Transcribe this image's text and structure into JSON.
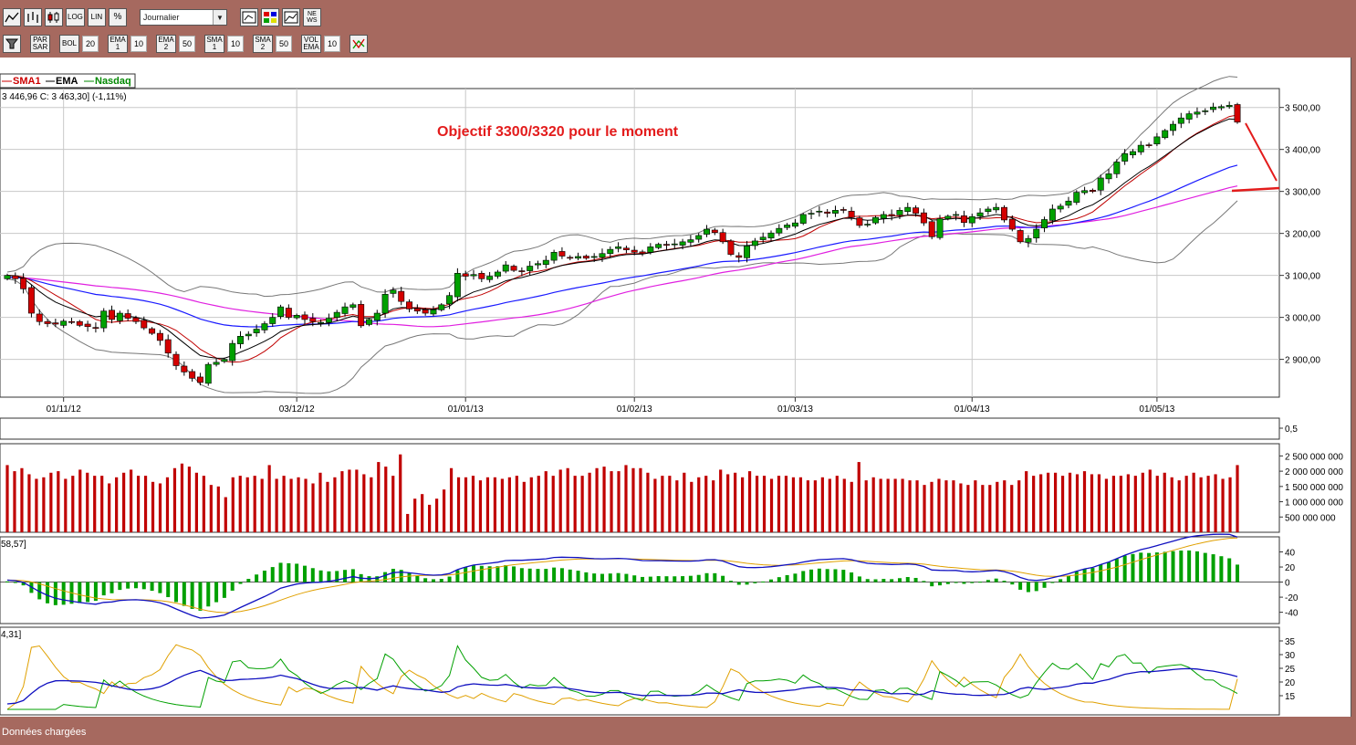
{
  "toolbar_top": {
    "chart_type_icons": [
      "line-chart-icon",
      "bar-chart-icon",
      "candlestick-icon"
    ],
    "scale_buttons": [
      "LOG",
      "LIN",
      "%"
    ],
    "period_select": "Journalier",
    "right_icons": [
      "zoom-icon",
      "color-palette-icon",
      "compare-icon",
      "news-icon"
    ],
    "news_label": "NE WS"
  },
  "toolbar_indicators": [
    {
      "label": "PAR SAR",
      "value": ""
    },
    {
      "label": "BOL",
      "value": "20"
    },
    {
      "label": "EMA 1",
      "value": "10"
    },
    {
      "label": "EMA 2",
      "value": "50"
    },
    {
      "label": "SMA 1",
      "value": "10"
    },
    {
      "label": "SMA 2",
      "value": "50"
    },
    {
      "label": "VOL EMA",
      "value": "10"
    }
  ],
  "legend": {
    "items": [
      {
        "label": "SMA1",
        "color": "#cc0000"
      },
      {
        "label": "EMA",
        "color": "#000000"
      },
      {
        "label": "Nasdaq",
        "color": "#008800"
      }
    ],
    "ohlc_text": "3 446,96  C: 3 463,30] (-1,11%)"
  },
  "annotation": {
    "text": "Objectif 3300/3320 pour le moment",
    "color": "#e31c1c"
  },
  "macd_panel_label": "58,57]",
  "dmi_panel_label": "4,31]",
  "status_text": "Données chargées",
  "colors": {
    "frame": "#a6695f",
    "candle_up": "#00a000",
    "candle_down": "#d40000",
    "volume": "#c00000",
    "bollinger": "#777777",
    "ema50": "#1a1aff",
    "sma50": "#e020e0",
    "sma10": "#c00000",
    "signal": "#e0a000",
    "dmi_plus": "#00a000"
  },
  "chart_data": [
    {
      "type": "candlestick",
      "title": "",
      "x_tick_labels": [
        "01/11/12",
        "03/12/12",
        "01/01/13",
        "01/02/13",
        "01/03/13",
        "01/04/13",
        "01/05/13"
      ],
      "y_tick_labels": [
        "3 500,00",
        "3 400,00",
        "3 300,00",
        "3 200,00",
        "3 100,00",
        "3 000,00",
        "2 900,00"
      ],
      "ylim": [
        2810,
        3545
      ],
      "close_series": [
        3100,
        3092,
        3068,
        3010,
        2990,
        2985,
        2984,
        2991,
        2989,
        2981,
        2978,
        2975,
        3015,
        2995,
        3010,
        2998,
        2990,
        2975,
        2962,
        2945,
        2915,
        2885,
        2870,
        2855,
        2845,
        2888,
        2893,
        2900,
        2938,
        2955,
        2960,
        2972,
        2985,
        3000,
        3025,
        3000,
        3005,
        2995,
        2990,
        2988,
        2998,
        3012,
        3025,
        3030,
        2980,
        2995,
        3010,
        3055,
        3065,
        3038,
        3020,
        3015,
        3010,
        3018,
        3030,
        3052,
        3105,
        3098,
        3102,
        3092,
        3098,
        3108,
        3125,
        3112,
        3110,
        3122,
        3128,
        3136,
        3155,
        3146,
        3142,
        3145,
        3141,
        3145,
        3152,
        3162,
        3168,
        3161,
        3155,
        3152,
        3168,
        3174,
        3172,
        3175,
        3180,
        3185,
        3195,
        3210,
        3202,
        3180,
        3150,
        3143,
        3170,
        3182,
        3191,
        3201,
        3212,
        3220,
        3225,
        3245,
        3248,
        3253,
        3248,
        3255,
        3256,
        3238,
        3219,
        3222,
        3238,
        3245,
        3242,
        3255,
        3262,
        3248,
        3225,
        3192,
        3235,
        3241,
        3245,
        3226,
        3240,
        3249,
        3258,
        3262,
        3232,
        3210,
        3180,
        3188,
        3210,
        3233,
        3258,
        3265,
        3277,
        3298,
        3302,
        3300,
        3332,
        3342,
        3370,
        3390,
        3395,
        3410,
        3410,
        3430,
        3445,
        3460,
        3475,
        3485,
        3489,
        3492,
        3501,
        3502,
        3505,
        3465
      ],
      "series": [
        {
          "name": "SMA1"
        },
        {
          "name": "EMA"
        },
        {
          "name": "Nasdaq"
        }
      ]
    },
    {
      "type": "bar",
      "title": "",
      "y_tick_labels": [
        "2 500 000 000",
        "2 000 000 000",
        "1 500 000 000",
        "1 000 000 000",
        "500 000 000"
      ],
      "ylim": [
        0,
        2900000000
      ],
      "values": [
        2200000000,
        2000000000,
        2100000000,
        1900000000,
        1750000000,
        1800000000,
        1950000000,
        2000000000,
        1750000000,
        1850000000,
        2050000000,
        1950000000,
        1850000000,
        1850000000,
        1600000000,
        1800000000,
        1950000000,
        2050000000,
        1850000000,
        1850000000,
        1650000000,
        1600000000,
        1800000000,
        2100000000,
        2250000000,
        2150000000,
        1950000000,
        1850000000,
        1550000000,
        1500000000,
        1150000000,
        1800000000,
        1850000000,
        1800000000,
        1850000000,
        1750000000,
        2200000000,
        1750000000,
        1850000000,
        1750000000,
        1800000000,
        1750000000,
        1600000000,
        1950000000,
        1650000000,
        1800000000,
        2000000000,
        2050000000,
        2050000000,
        1900000000,
        1800000000,
        2300000000,
        2150000000,
        1850000000,
        2550000000,
        600000000,
        1100000000,
        1250000000,
        900000000,
        1100000000,
        1400000000,
        2100000000,
        1800000000,
        1800000000,
        1850000000,
        1700000000,
        1800000000,
        1800000000,
        1750000000,
        1800000000,
        1850000000,
        1650000000,
        1800000000,
        1850000000,
        2000000000,
        1850000000,
        2050000000,
        2100000000,
        1850000000,
        1850000000,
        1950000000,
        2100000000,
        2150000000,
        2000000000,
        2000000000,
        2200000000,
        2100000000,
        2100000000,
        1950000000,
        1750000000,
        1850000000,
        1850000000,
        1700000000,
        1950000000,
        1650000000,
        1800000000,
        1850000000,
        1700000000,
        2050000000,
        1900000000,
        1950000000,
        1800000000,
        2000000000,
        1850000000,
        1850000000,
        1750000000,
        1850000000,
        1850000000,
        1800000000,
        1800000000,
        1700000000,
        1700000000,
        1800000000,
        1750000000,
        1850000000,
        1750000000,
        1650000000,
        2300000000,
        1700000000,
        1800000000,
        1750000000,
        1750000000,
        1750000000,
        1750000000,
        1700000000,
        1700000000,
        1550000000,
        1650000000,
        1750000000,
        1700000000,
        1700000000,
        1600000000,
        1550000000,
        1700000000,
        1550000000,
        1550000000,
        1650000000,
        1700000000,
        1550000000,
        1700000000,
        2000000000,
        1850000000,
        1900000000,
        1950000000,
        1950000000,
        1850000000,
        1950000000,
        1900000000,
        2000000000,
        1900000000,
        1900000000,
        1750000000,
        1850000000,
        1850000000,
        1900000000,
        1850000000,
        1950000000,
        2050000000,
        1850000000,
        1950000000,
        1800000000,
        1700000000,
        1850000000,
        1950000000,
        1800000000,
        1850000000,
        1900000000,
        1750000000,
        1800000000,
        2200000000
      ]
    },
    {
      "type": "line",
      "title": "",
      "y_tick_labels": [
        "40",
        "20",
        "0",
        "-20",
        "-40"
      ],
      "ylim": [
        -55,
        60
      ]
    },
    {
      "type": "line",
      "title": "",
      "y_tick_labels": [
        "35",
        "30",
        "25",
        "20",
        "15"
      ],
      "ylim": [
        8,
        40
      ]
    }
  ]
}
